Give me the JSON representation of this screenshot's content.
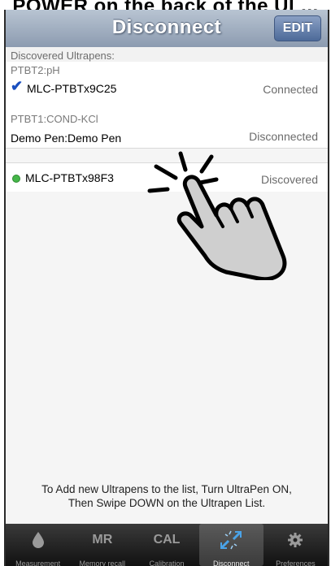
{
  "top_caption": "POWER on the back of the UL...",
  "navbar": {
    "title": "Disconnect",
    "edit_label": "EDIT"
  },
  "section": {
    "header": "Discovered Ultrapens:"
  },
  "devices": [
    {
      "sub": "PTBT2:pH",
      "name": "MLC-PTBTx9C25",
      "status": "Connected",
      "marker": "check"
    },
    {
      "sub": "PTBT1:COND-KCl",
      "name": "Demo Pen:Demo Pen",
      "status": "Disconnected",
      "marker": "none"
    },
    {
      "sub": "",
      "name": "MLC-PTBTx98F3",
      "status": "Discovered",
      "marker": "green-dot"
    }
  ],
  "hint": {
    "line1": "To Add new Ultrapens to the list, Turn UltraPen ON,",
    "line2": "Then Swipe DOWN on the Ultrapen List."
  },
  "tabs": [
    {
      "label": "Measurement",
      "icon": "drop-icon",
      "active": false
    },
    {
      "label": "Memory recall",
      "icon_text": "MR",
      "active": false
    },
    {
      "label": "Calibration",
      "icon_text": "CAL",
      "active": false
    },
    {
      "label": "Disconnect",
      "icon": "disconnect-arrows-icon",
      "active": true
    },
    {
      "label": "Preferences",
      "icon": "gear-icon",
      "active": false
    }
  ],
  "colors": {
    "navbar": "#9aa8bc",
    "check": "#1a4fbf",
    "dot": "#45b649",
    "tabbar": "#1f1f1f"
  }
}
